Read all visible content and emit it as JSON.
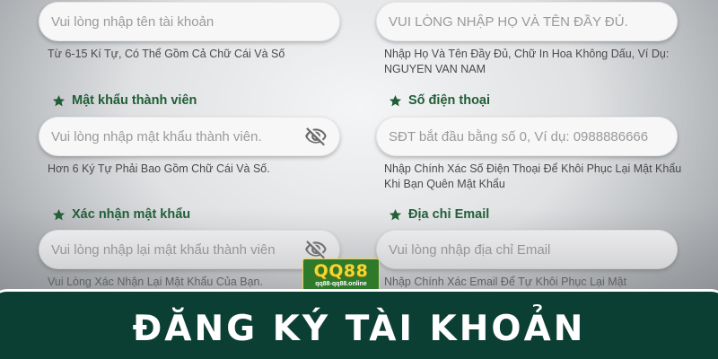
{
  "form": {
    "username": {
      "placeholder": "Vui lòng nhập tên tài khoản",
      "hint": "Từ 6-15 Kí Tự, Có Thể Gồm Cả Chữ Cái Và Số"
    },
    "fullname": {
      "placeholder": "VUI LÒNG NHẬP HỌ VÀ TÊN ĐẦY ĐỦ.",
      "hint": "Nhập Họ Và Tên Đầy Đủ, Chữ In Hoa Không Dấu, Ví Dụ: NGUYEN VAN NAM"
    },
    "password": {
      "label": "Mật khẩu thành viên",
      "placeholder": "Vui lòng nhập mật khẩu thành viên.",
      "hint": "Hơn 6 Ký Tự Phải Bao Gồm Chữ Cái Và Số."
    },
    "phone": {
      "label": "Số điện thoại",
      "placeholder": "SĐT bắt đầu bằng số 0, Ví dụ: 0988886666",
      "hint": "Nhập Chính Xác Số Điện Thoại Để Khôi Phục Lại Mật Khẩu Khi Bạn Quên Mật Khẩu"
    },
    "confirm_password": {
      "label": "Xác nhận mật khẩu",
      "placeholder": "Vui lòng nhập lại mật khẩu thành viên",
      "hint": "Vui Lòng Xác Nhận Lại Mật Khẩu Của Bạn."
    },
    "email": {
      "label": "Địa chỉ Email",
      "placeholder": "Vui lòng nhập địa chỉ Email",
      "hint": "Nhập Chính Xác Email Để Tự Khôi Phục Lại Mật"
    }
  },
  "logo": {
    "brand": "QQ88",
    "domain": "qq88-qq88.online"
  },
  "banner": {
    "title": "ĐĂNG KÝ TÀI KHOẢN"
  },
  "colors": {
    "label_green": "#1f5e36",
    "banner_bg": "#0c3f34",
    "logo_yellow": "#f7d531",
    "logo_green": "#2f7a2a"
  },
  "icons": {
    "label_marker": "star-icon",
    "password_toggle": "eye-slash-icon"
  }
}
